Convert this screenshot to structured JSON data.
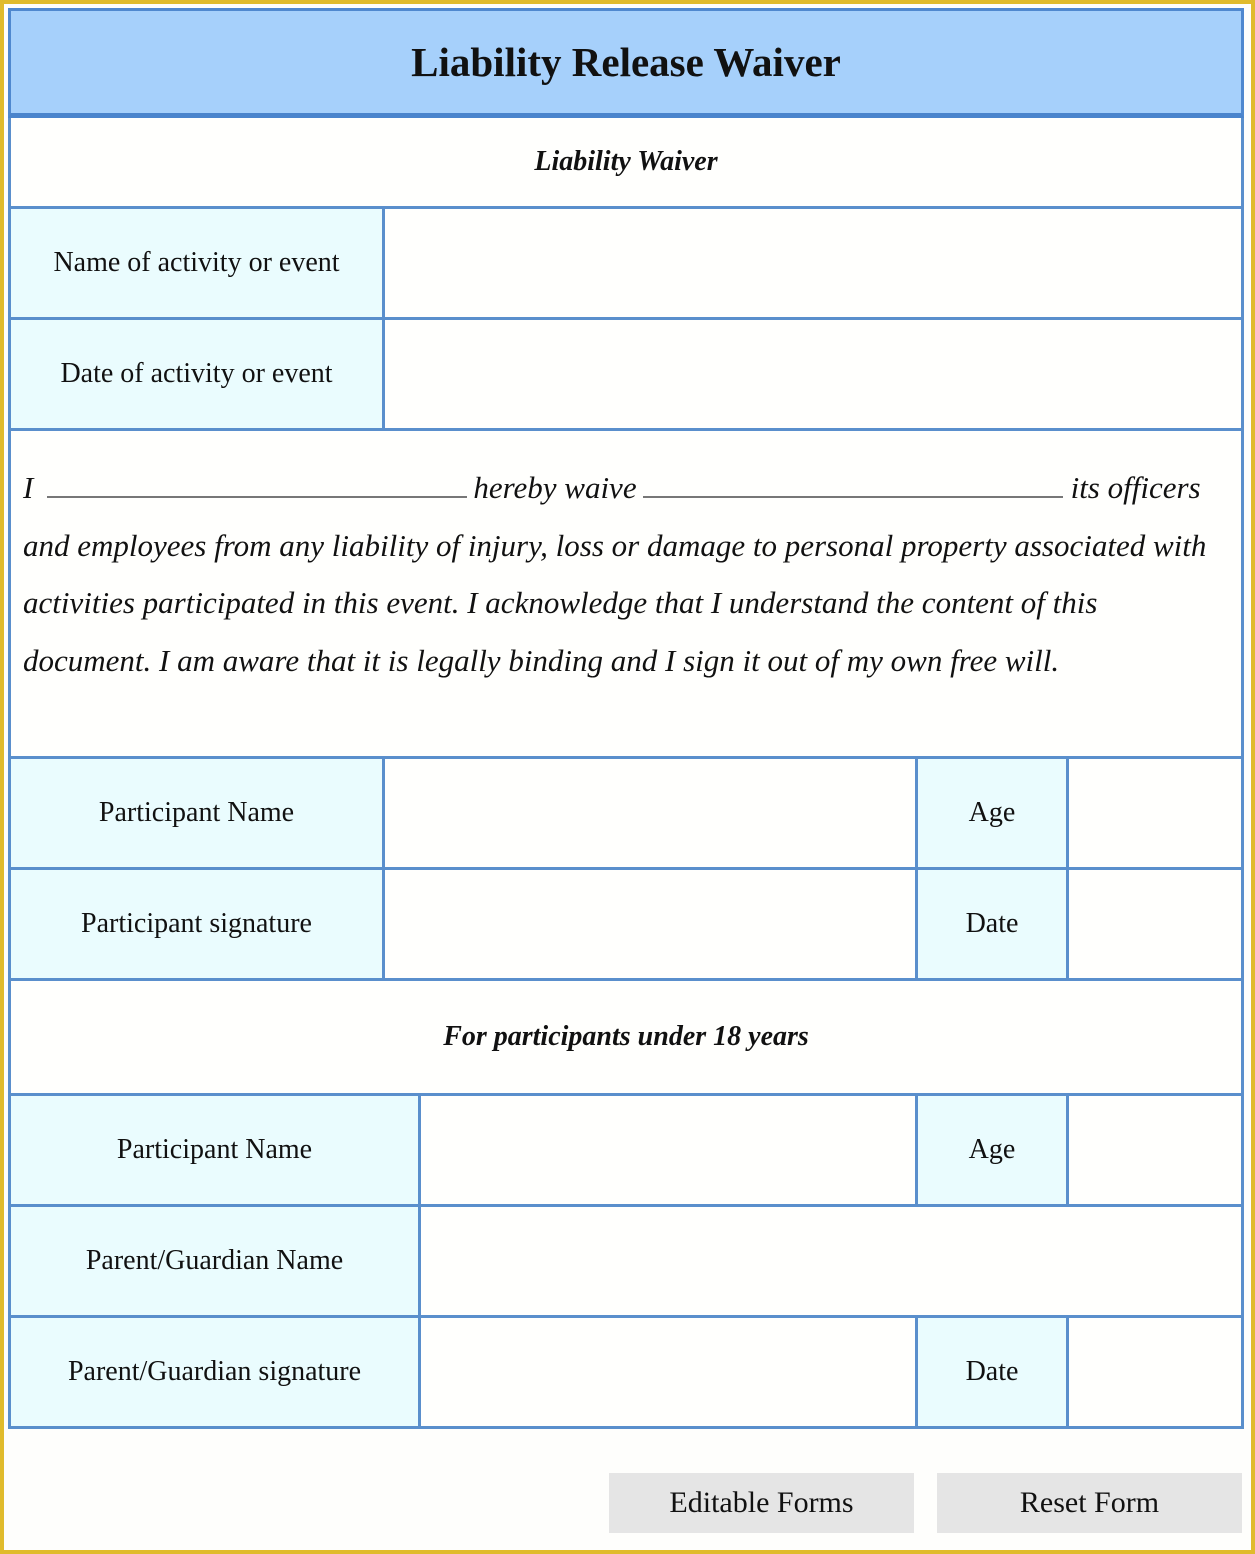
{
  "form": {
    "title": "Liability Release Waiver",
    "section_waiver": "Liability Waiver",
    "activity_rows": [
      {
        "label": "Name of activity or event",
        "value": ""
      },
      {
        "label": "Date of activity or event",
        "value": ""
      }
    ],
    "statement": {
      "prefix": "I",
      "middle": "hereby waive",
      "after_second_blank": "its officers",
      "rest": "and employees from any liability of injury, loss or damage to personal property associated with activities participated in this event. I acknowledge that I understand the content of this document. I am aware that it is legally binding and I sign it out of my own free will.",
      "name_blank_value": "",
      "organization_blank_value": ""
    },
    "participant_rows": [
      {
        "label": "Participant Name",
        "value": "",
        "side_label": "Age",
        "side_value": ""
      },
      {
        "label": "Participant signature",
        "value": "",
        "side_label": "Date",
        "side_value": ""
      }
    ],
    "section_minors": "For participants under 18 years",
    "minor_rows": [
      {
        "label": "Participant Name",
        "value": "",
        "side_label": "Age",
        "side_value": ""
      },
      {
        "label": "Parent/Guardian Name",
        "value": ""
      },
      {
        "label": "Parent/Guardian signature",
        "value": "",
        "side_label": "Date",
        "side_value": ""
      }
    ]
  },
  "buttons": {
    "editable_forms": "Editable Forms",
    "reset_form": "Reset Form"
  },
  "colors": {
    "frame": "#e0bb2c",
    "title_bg": "#a6d0fb",
    "border": "#5a8fcc",
    "label_bg": "#eafcfe",
    "button_bg": "#e5e5e5"
  }
}
